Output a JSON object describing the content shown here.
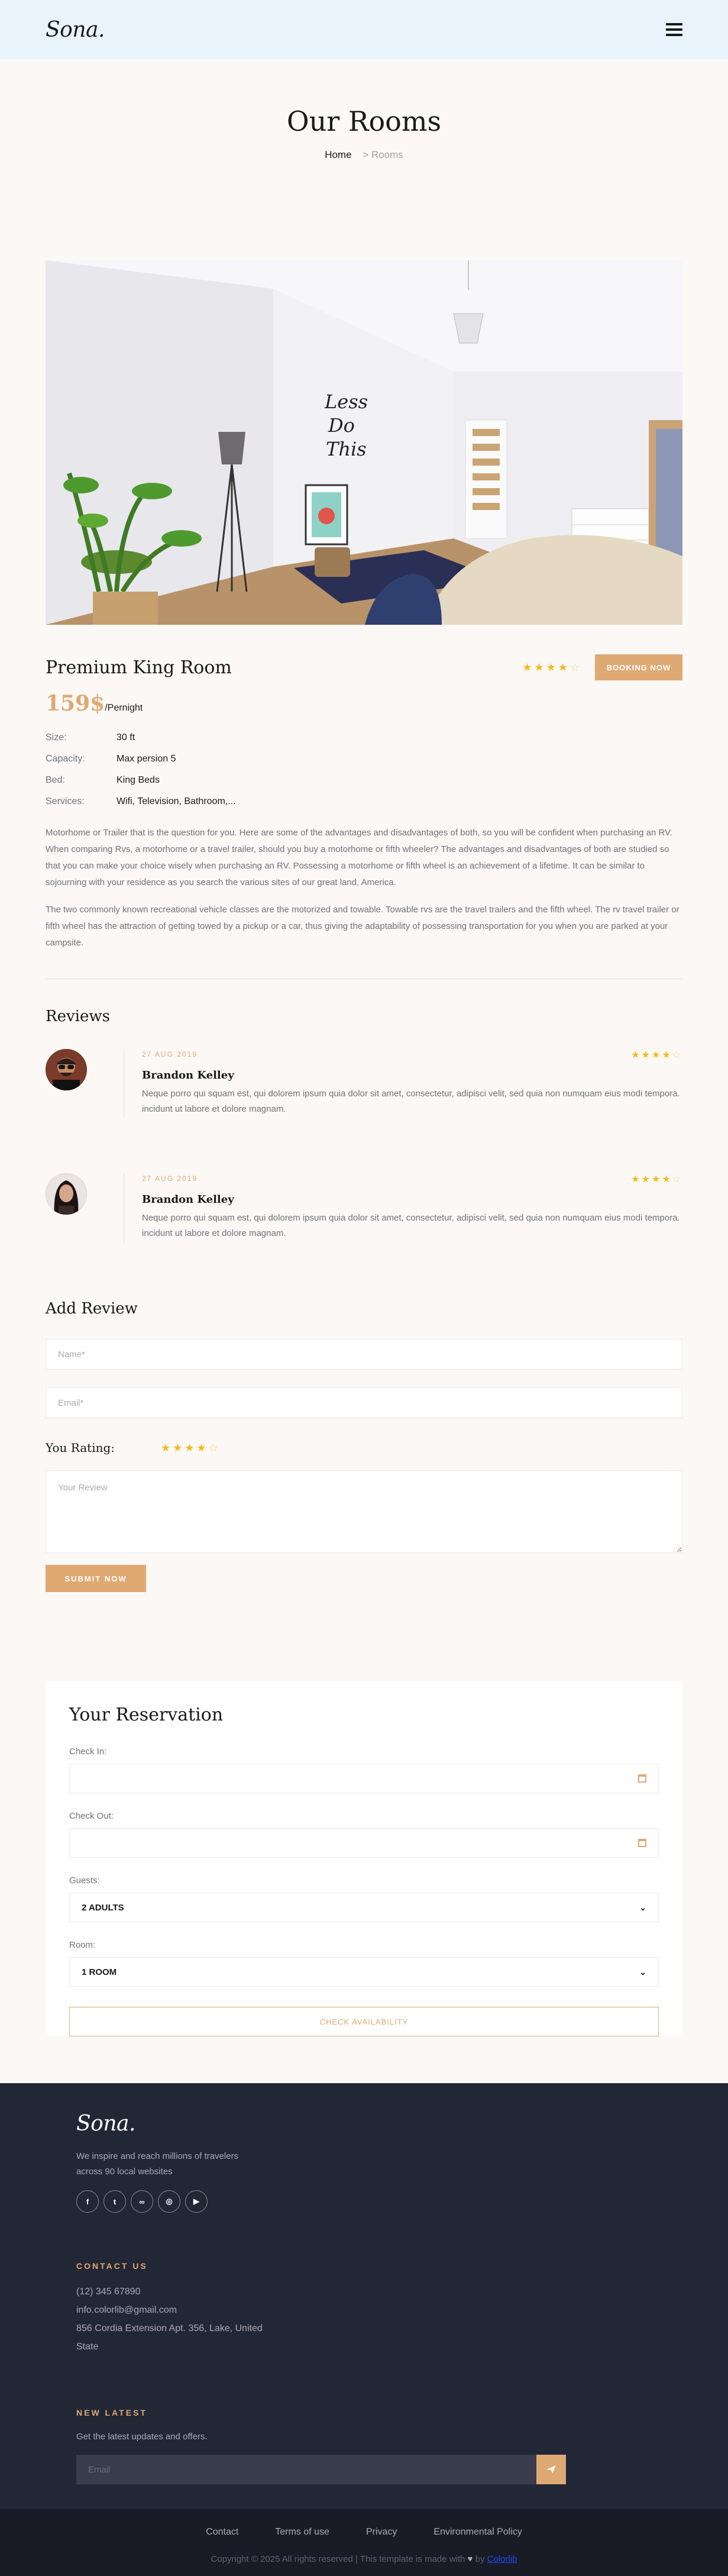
{
  "header": {
    "logo": "Sona."
  },
  "hero": {
    "title": "Our Rooms",
    "breadcrumb_home": "Home",
    "breadcrumb_current": "> Rooms"
  },
  "room": {
    "title": "Premium King Room",
    "rating_stars": 4.5,
    "book_label": "Booking Now",
    "price": "159$",
    "price_unit": "/Pernight",
    "specs": [
      {
        "label": "Size:",
        "value": "30 ft"
      },
      {
        "label": "Capacity:",
        "value": "Max persion 5"
      },
      {
        "label": "Bed:",
        "value": "King Beds"
      },
      {
        "label": "Services:",
        "value": "Wifi, Television, Bathroom,..."
      }
    ],
    "description_1": "Motorhome or Trailer that is the question for you. Here are some of the advantages and disadvantages of both, so you will be confident when purchasing an RV. When comparing Rvs, a motorhome or a travel trailer, should you buy a motorhome or fifth wheeler? The advantages and disadvantages of both are studied so that you can make your choice wisely when purchasing an RV. Possessing a motorhome or fifth wheel is an achievement of a lifetime. It can be similar to sojourning with your residence as you search the various sites of our great land, America.",
    "description_2": "The two commonly known recreational vehicle classes are the motorized and towable. Towable rvs are the travel trailers and the fifth wheel. The rv travel trailer or fifth wheel has the attraction of getting towed by a pickup or a car, thus giving the adaptability of possessing transportation for you when you are parked at your campsite.",
    "poster_text": [
      "Less",
      "Do",
      "This"
    ]
  },
  "reviews": {
    "title": "Reviews",
    "items": [
      {
        "date": "27 Aug 2019",
        "name": "Brandon Kelley",
        "text": "Neque porro qui squam est, qui dolorem ipsum quia dolor sit amet, consectetur, adipisci velit, sed quia non numquam eius modi tempora. incidunt ut labore et dolore magnam.",
        "stars": 4.5
      },
      {
        "date": "27 Aug 2019",
        "name": "Brandon Kelley",
        "text": "Neque porro qui squam est, qui dolorem ipsum quia dolor sit amet, consectetur, adipisci velit, sed quia non numquam eius modi tempora. incidunt ut labore et dolore magnam.",
        "stars": 4.5
      }
    ]
  },
  "review_form": {
    "title": "Add Review",
    "name_placeholder": "Name*",
    "email_placeholder": "Email*",
    "rating_label": "You Rating:",
    "rating_stars": 4.5,
    "review_placeholder": "Your Review",
    "submit_label": "Submit Now"
  },
  "reservation": {
    "title": "Your Reservation",
    "check_in_label": "Check In:",
    "check_in_value": "",
    "check_out_label": "Check Out:",
    "check_out_value": "",
    "guests_label": "Guests:",
    "guests_value": "2 Adults",
    "room_label": "Room:",
    "room_value": "1 Room",
    "check_button": "Check Availability"
  },
  "footer": {
    "logo": "Sona.",
    "description": "We inspire and reach millions of travelers across 90 local websites",
    "socials": [
      "facebook-icon",
      "twitter-icon",
      "tripadvisor-icon",
      "instagram-icon",
      "youtube-icon"
    ],
    "contact_heading": "Contact Us",
    "phone": "(12) 345 67890",
    "email": "info.colorlib@gmail.com",
    "address": "856 Cordia Extension Apt. 356, Lake, United State",
    "news_heading": "New Latest",
    "news_text": "Get the latest updates and offers.",
    "news_placeholder": "Email",
    "links": [
      "Contact",
      "Terms of use",
      "Privacy",
      "Environmental Policy"
    ],
    "copyright_prefix": "Copyright © 2025 All rights reserved | This template is made with",
    "copyright_by": "by",
    "copyright_brand": "Colorlib"
  },
  "colors": {
    "accent": "#dfa974",
    "star": "#f5b917",
    "header_bg": "#e8f3fc",
    "footer_bg": "#222736",
    "footer_bottom_bg": "#191c26"
  }
}
